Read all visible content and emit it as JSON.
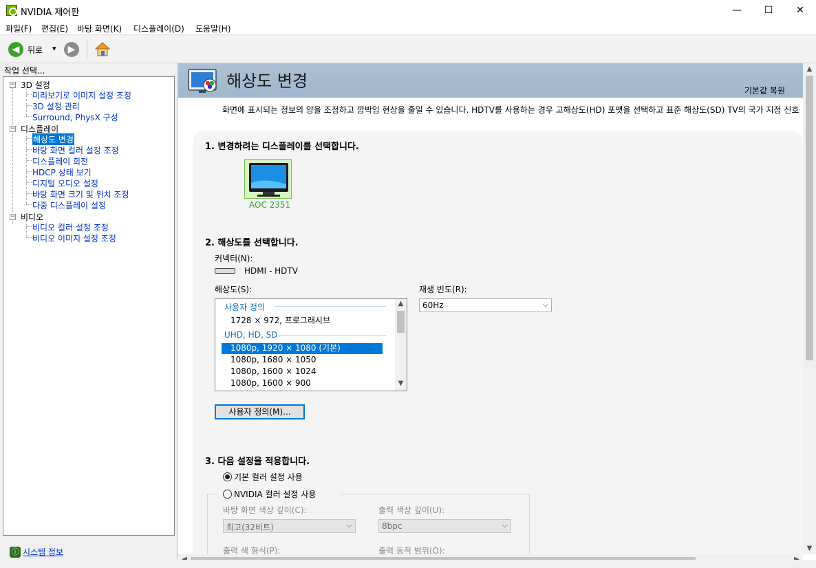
{
  "window": {
    "title": "NVIDIA 제어판",
    "controls": {
      "minimize": "—",
      "maximize": "☐",
      "close": "✕"
    }
  },
  "menu": [
    "파일(F)",
    "편집(E)",
    "바탕 화면(K)",
    "디스플레이(D)",
    "도움말(H)"
  ],
  "toolbar": {
    "back_label": "뒤로",
    "back_dropdown": "▾"
  },
  "sidebar": {
    "task_label": "작업 선택...",
    "groups": [
      {
        "label": "3D 설정",
        "items": [
          "미리보기로 이미지 설정 조정",
          "3D 설정 관리",
          "Surround, PhysX 구성"
        ]
      },
      {
        "label": "디스플레이",
        "items": [
          "해상도 변경",
          "바탕 화면 컬러 설정 조정",
          "디스플레이 회전",
          "HDCP 상태 보기",
          "디지털 오디오 설정",
          "바탕 화면 크기 및 위치 조정",
          "다중 디스플레이 설정"
        ]
      },
      {
        "label": "비디오",
        "items": [
          "비디오 컬러 설정 조정",
          "비디오 이미지 설정 조정"
        ]
      }
    ],
    "selected_item": "해상도 변경",
    "system_info": "시스템 정보"
  },
  "page": {
    "title": "해상도 변경",
    "restore_defaults": "기본값 복원",
    "description": "화면에 표시되는 정보의 양을 조정하고 깜박임 현상을 줄일 수 있습니다. HDTV를 사용하는 경우 고해상도(HD) 포맷을 선택하고 표준 해상도(SD) TV의 국가 지정 신호를 선"
  },
  "section1": {
    "title": "1. 변경하려는 디스플레이를 선택합니다.",
    "display_name": "AOC 2351"
  },
  "section2": {
    "title": "2. 해상도를 선택합니다.",
    "connector_label": "커넥터(N):",
    "connector_value": "HDMI - HDTV",
    "resolution_label": "해상도(S):",
    "refresh_label": "재생 빈도(R):",
    "refresh_value": "60Hz",
    "custom_group": "사용자 정의",
    "custom_rows": [
      "1728 × 972, 프로그래시브"
    ],
    "hd_group": "UHD, HD, SD",
    "hd_rows": [
      "1080p, 1920 × 1080 (기본)",
      "1080p, 1680 × 1050",
      "1080p, 1600 × 1024",
      "1080p, 1600 × 900"
    ],
    "customize_button": "사용자 정의(M)..."
  },
  "section3": {
    "title": "3. 다음 설정을 적용합니다.",
    "radio_default": "기본 컬러 설정 사용",
    "radio_nvidia": "NVIDIA 컬러 설정 사용",
    "desktop_depth_label": "바탕 화면 색상 깊이(C):",
    "desktop_depth_value": "최고(32비트)",
    "output_depth_label": "출력 색상 깊이(U):",
    "output_depth_value": "8bpc",
    "output_format_label": "출력 색 형식(P):",
    "output_range_label": "출력 동적 범위(O):"
  },
  "colors": {
    "accent": "#0078d7",
    "nvidia_green": "#76b900",
    "link": "#0033cc",
    "header_band": "#a7bdd3"
  }
}
